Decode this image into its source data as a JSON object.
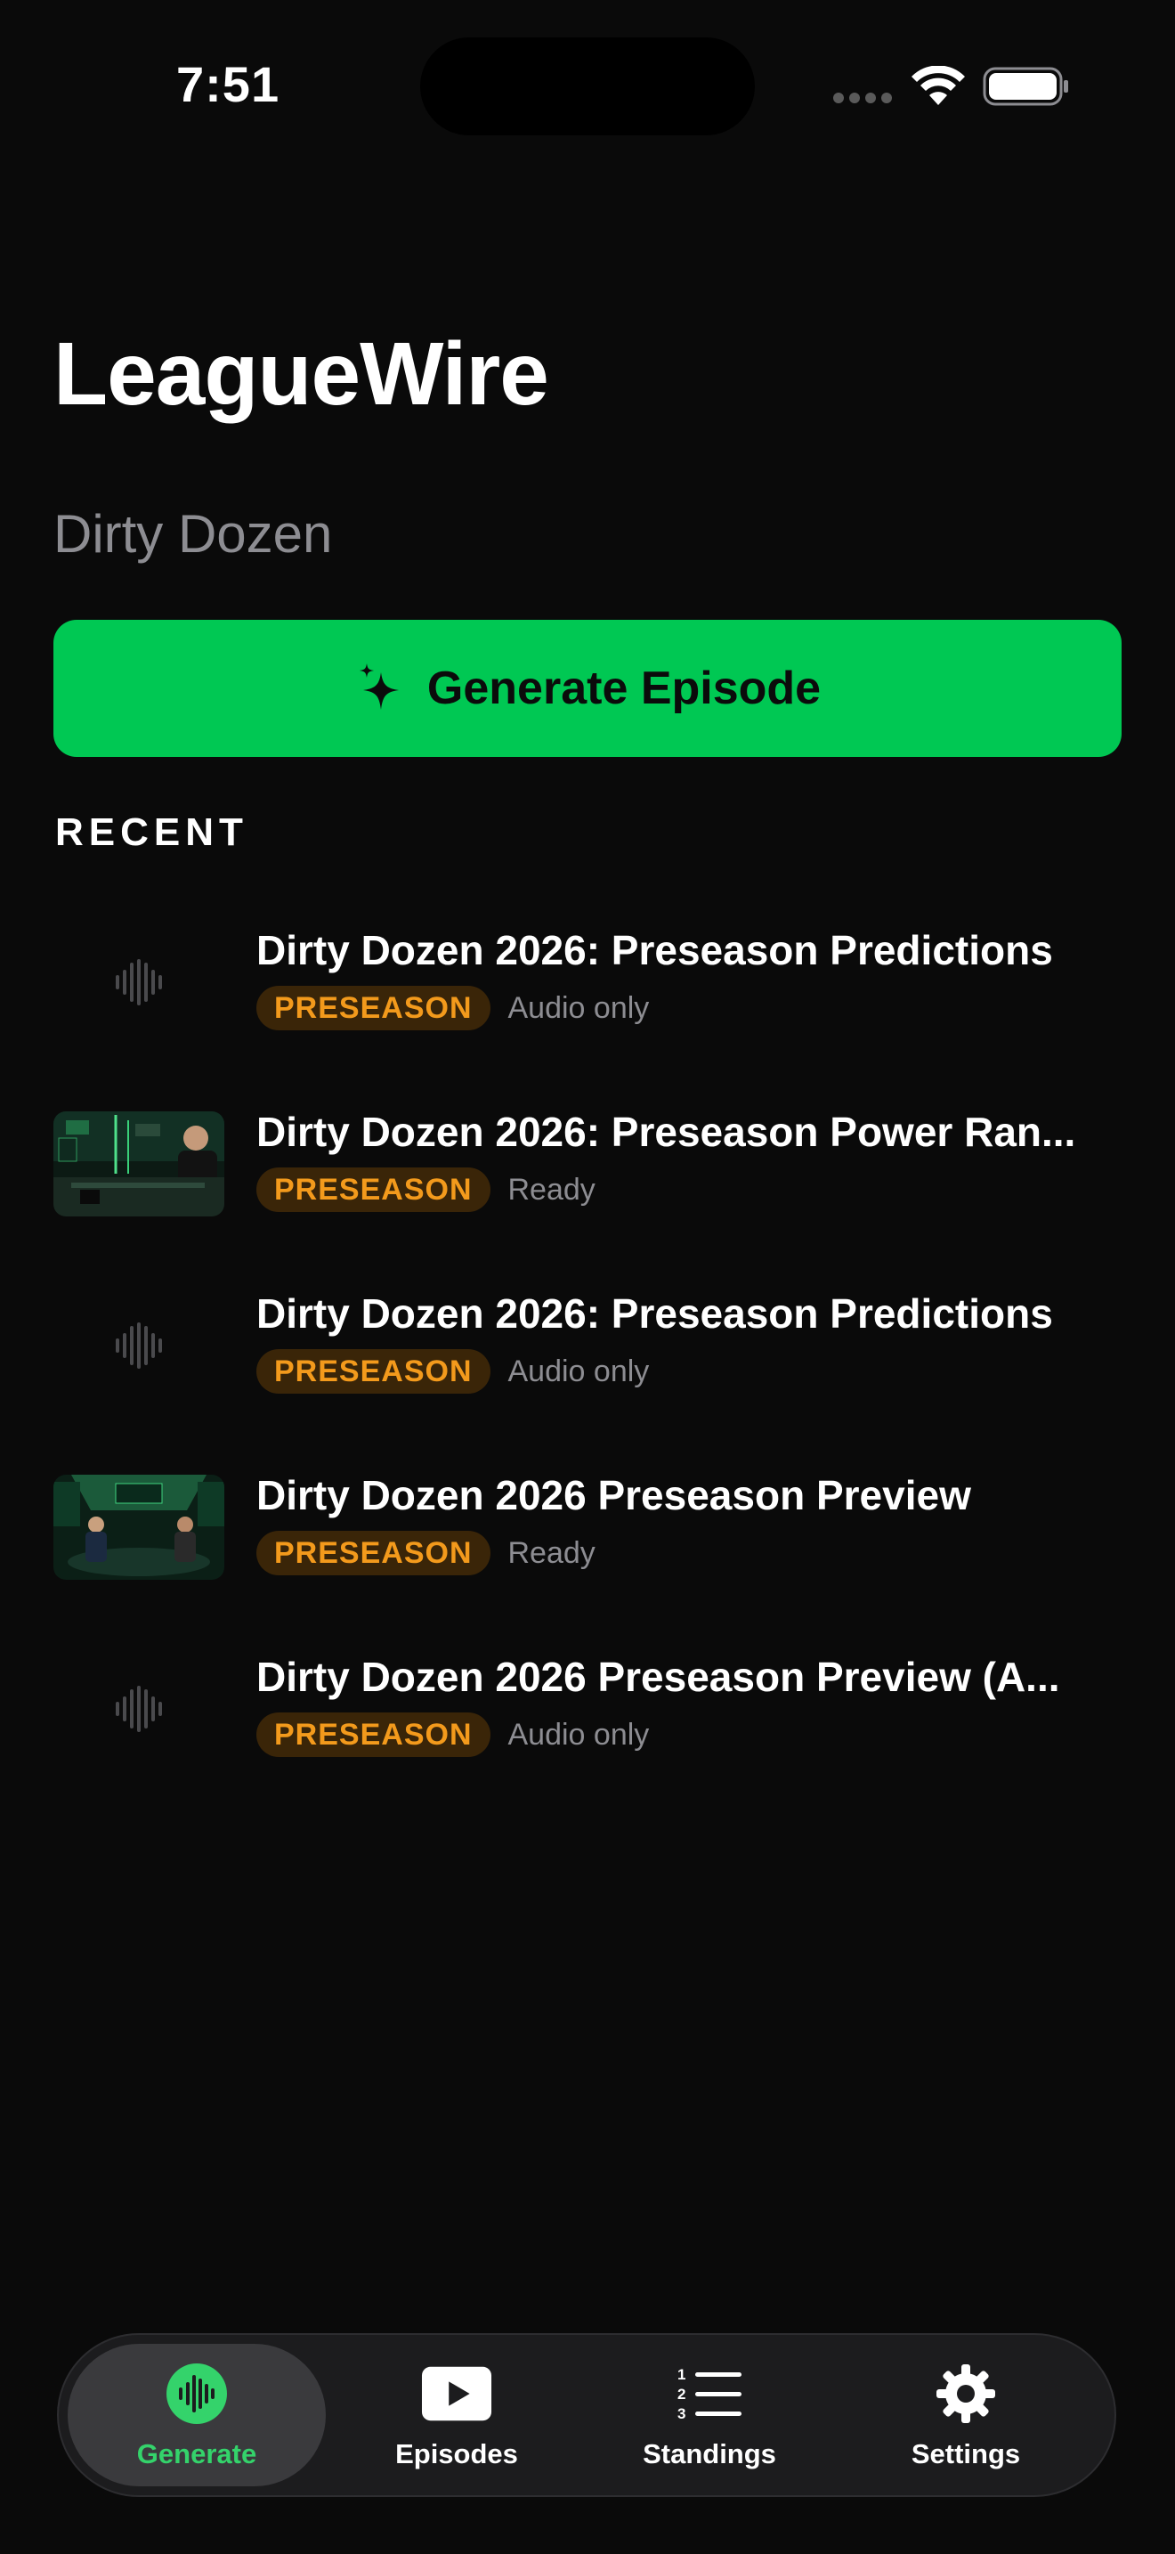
{
  "status_bar": {
    "time": "7:51"
  },
  "header": {
    "title": "LeagueWire",
    "league": "Dirty Dozen"
  },
  "generate_button": {
    "label": "Generate Episode",
    "icon": "sparkle-icon"
  },
  "recent": {
    "title": "RECENT",
    "episodes": [
      {
        "title": "Dirty Dozen 2026: Preseason Predictions",
        "badge": "PRESEASON",
        "status": "Audio only",
        "thumb": "waveform-icon"
      },
      {
        "title": "Dirty Dozen 2026: Preseason Power Ran...",
        "badge": "PRESEASON",
        "status": "Ready",
        "thumb": "video-thumbnail"
      },
      {
        "title": "Dirty Dozen 2026: Preseason Predictions",
        "badge": "PRESEASON",
        "status": "Audio only",
        "thumb": "waveform-icon"
      },
      {
        "title": "Dirty Dozen 2026 Preseason Preview",
        "badge": "PRESEASON",
        "status": "Ready",
        "thumb": "video-thumbnail"
      },
      {
        "title": "Dirty Dozen 2026 Preseason Preview (A...",
        "badge": "PRESEASON",
        "status": "Audio only",
        "thumb": "waveform-icon"
      }
    ]
  },
  "tab_bar": {
    "tabs": [
      {
        "label": "Generate",
        "icon": "waveform-icon",
        "active": true
      },
      {
        "label": "Episodes",
        "icon": "play-icon",
        "active": false
      },
      {
        "label": "Standings",
        "icon": "numbered-list-icon",
        "active": false
      },
      {
        "label": "Settings",
        "icon": "gear-icon",
        "active": false
      }
    ]
  },
  "colors": {
    "background": "#0a0a0a",
    "accent": "#00c853",
    "badge_text": "#f39a1c",
    "badge_bg": "#3a2508",
    "secondary_text": "#8d8d92",
    "tab_bar_bg": "#1c1c1e"
  }
}
